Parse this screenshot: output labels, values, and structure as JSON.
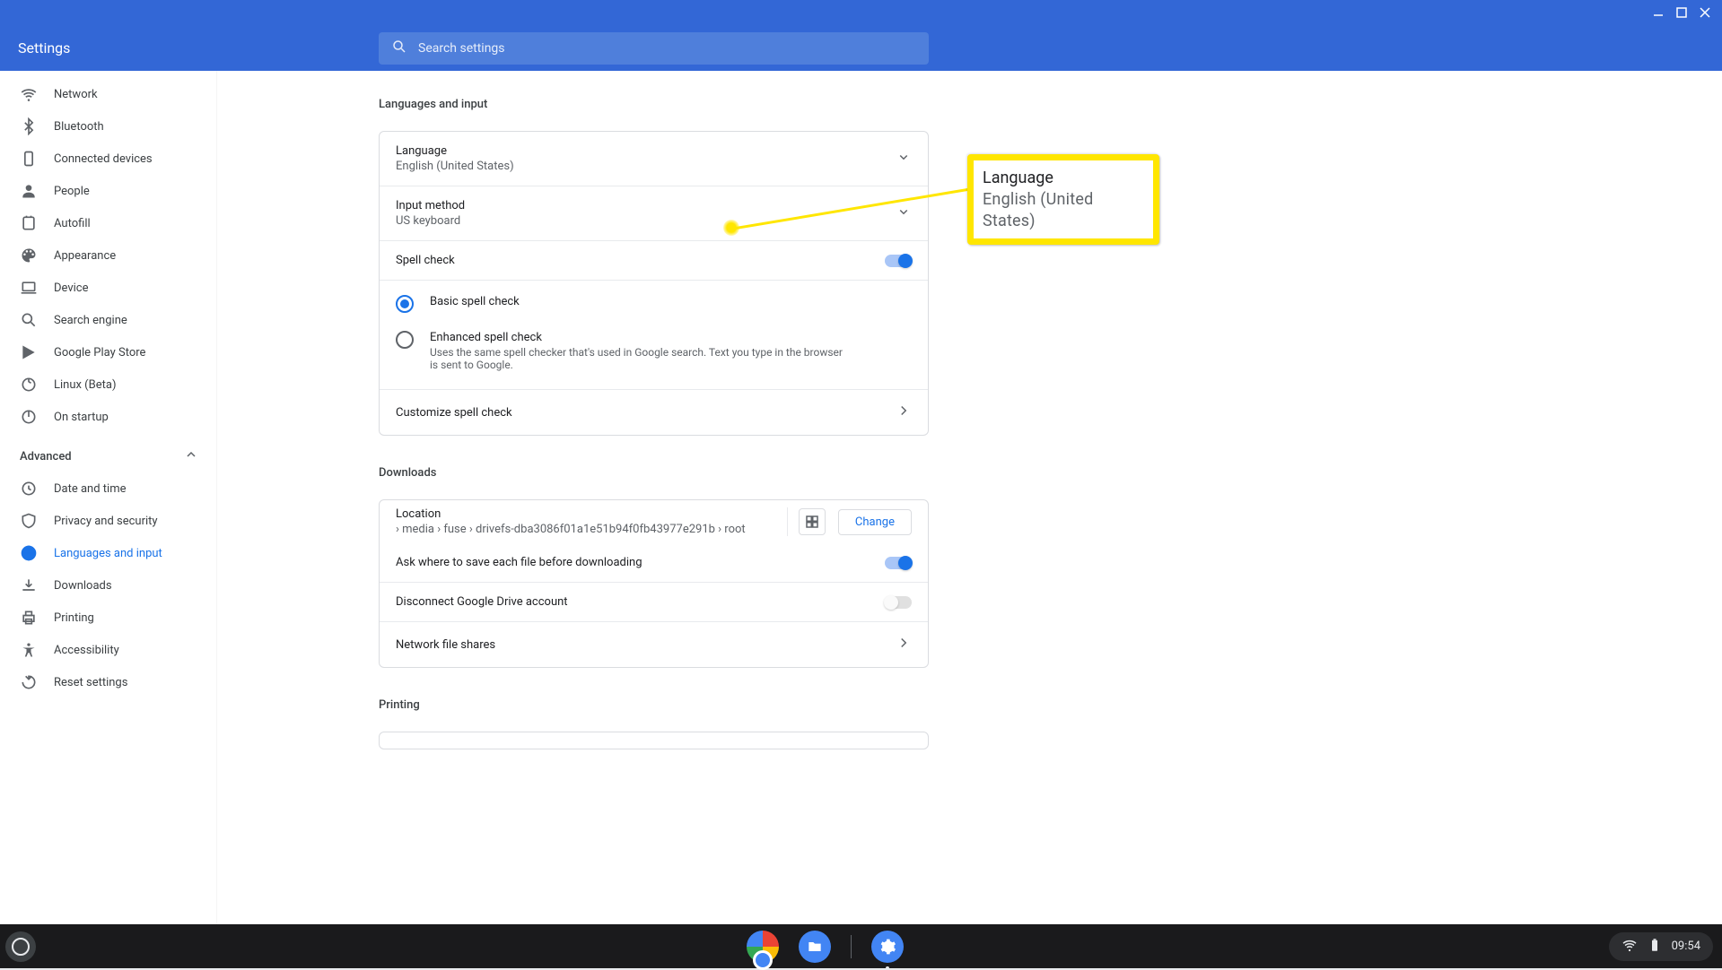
{
  "header": {
    "title": "Settings",
    "search_placeholder": "Search settings"
  },
  "sidebar": {
    "items": [
      "Network",
      "Bluetooth",
      "Connected devices",
      "People",
      "Autofill",
      "Appearance",
      "Device",
      "Search engine",
      "Google Play Store",
      "Linux (Beta)",
      "On startup"
    ],
    "advanced_label": "Advanced",
    "advanced_items": [
      "Date and time",
      "Privacy and security",
      "Languages and input",
      "Downloads",
      "Printing",
      "Accessibility",
      "Reset settings"
    ]
  },
  "content": {
    "lang_section_title": "Languages and input",
    "language": {
      "label": "Language",
      "value": "English (United States)"
    },
    "input_method": {
      "label": "Input method",
      "value": "US keyboard"
    },
    "spellcheck": {
      "label": "Spell check",
      "basic_label": "Basic spell check",
      "enhanced_label": "Enhanced spell check",
      "enhanced_desc": "Uses the same spell checker that's used in Google search. Text you type in the browser is sent to Google.",
      "customize_label": "Customize spell check"
    },
    "downloads_section_title": "Downloads",
    "downloads": {
      "location_label": "Location",
      "location_path": "› media › fuse › drivefs-dba3086f01a1e51b94f0fb43977e291b › root",
      "change_label": "Change",
      "ask_label": "Ask where to save each file before downloading",
      "disconnect_label": "Disconnect Google Drive account",
      "net_shares_label": "Network file shares"
    },
    "printing_section_title": "Printing"
  },
  "callout": {
    "title": "Language",
    "subtitle": "English (United States)"
  },
  "taskbar": {
    "time": "09:54"
  }
}
